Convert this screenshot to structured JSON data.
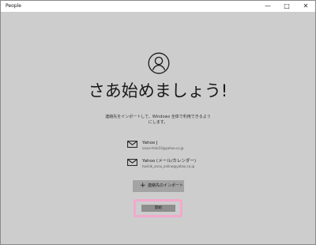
{
  "window": {
    "title": "People",
    "controls": {
      "minimize": "—",
      "maximize": "□",
      "close": "✕"
    }
  },
  "welcome": {
    "avatar_icon": "person-icon",
    "title": "さあ始めましょう!",
    "description": "連絡先をインポートして、Windows 全体で利用できるようにします。"
  },
  "accounts": [
    {
      "icon": "mail-icon",
      "name": "Yahoo J",
      "email": "ixxxx-hlnk10@yahoo.co.jp"
    },
    {
      "icon": "mail-icon",
      "name": "Yahoo (メール/カレンダー)",
      "email": "hoshik_anna_online@yahoo.co.jp"
    }
  ],
  "actions": {
    "import_icon": "plus-icon",
    "import_label": "連絡先のインポート",
    "start_label": "開始"
  },
  "colors": {
    "background": "#cdcdcd",
    "import_button": "#a4a4a4",
    "start_button": "#8e8e8e",
    "highlight": "#f2a9cc"
  }
}
